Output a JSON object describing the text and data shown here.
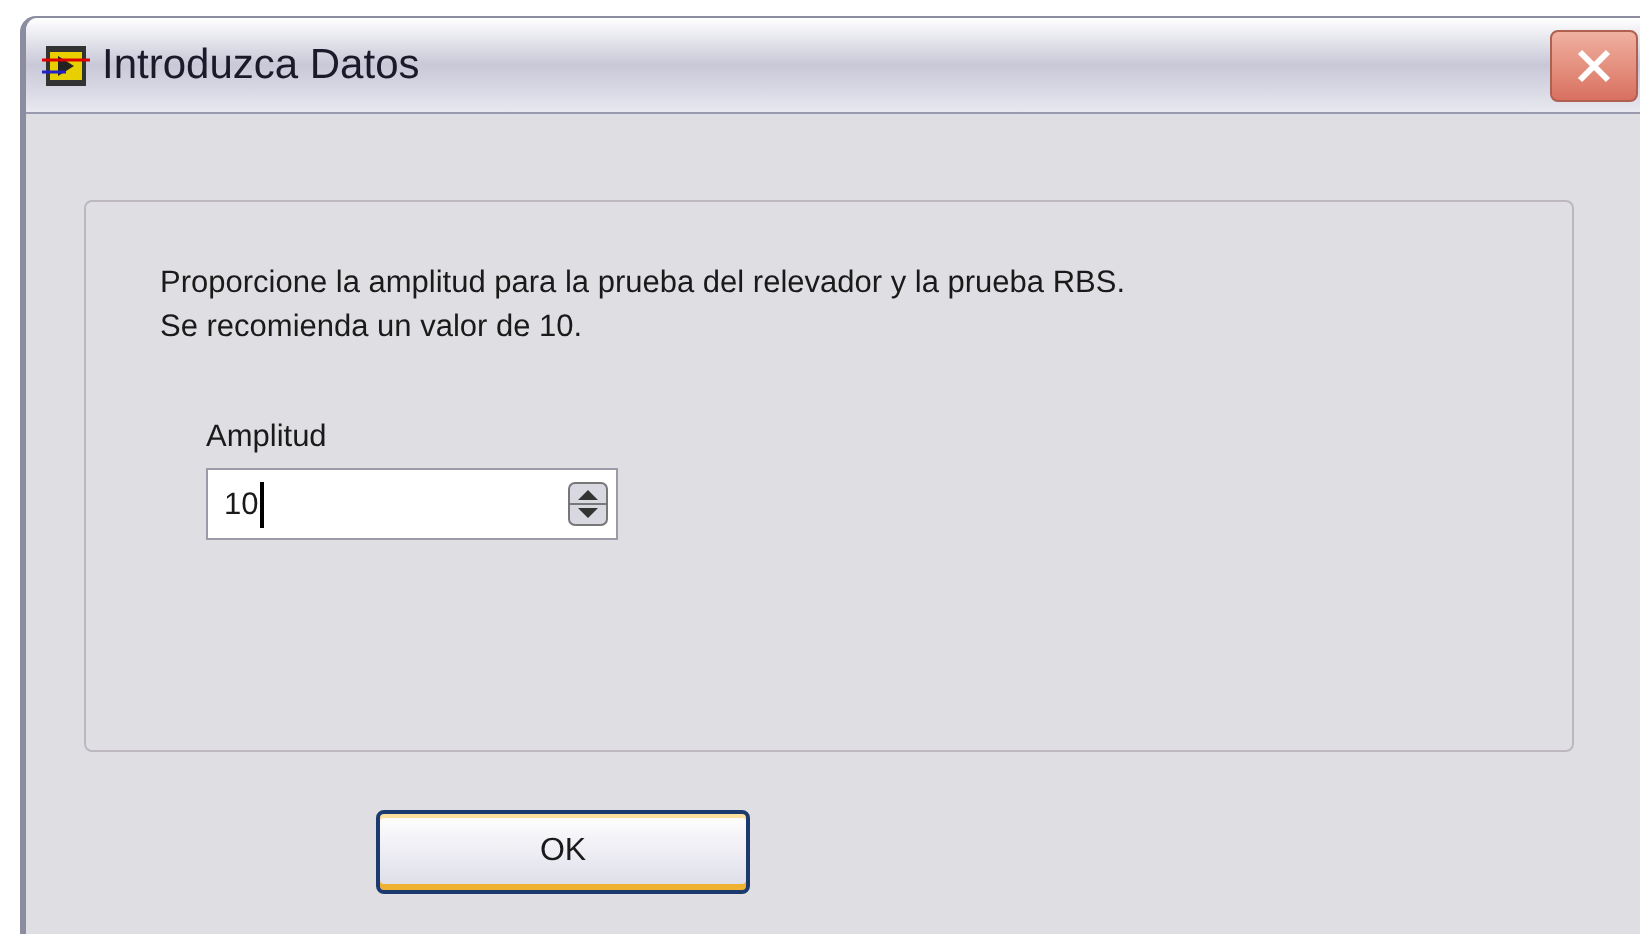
{
  "window": {
    "title": "Introduzca Datos"
  },
  "message": [
    "Proporcione la amplitud para la prueba del relevador y la prueba RBS.",
    "Se recomienda un valor de 10."
  ],
  "field": {
    "label": "Amplitud",
    "value": "10"
  },
  "buttons": [
    "OK"
  ]
}
